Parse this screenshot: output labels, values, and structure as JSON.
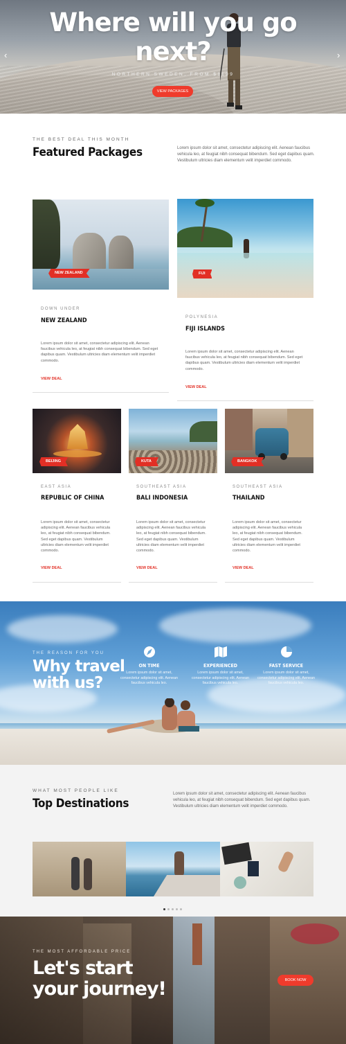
{
  "hero": {
    "title_line1": "Where will you go",
    "title_line2": "next?",
    "subtitle": "NORTHERN SWEDEN, FROM $1199",
    "cta": "VIEW PACKAGES"
  },
  "featured": {
    "eyebrow": "THE BEST DEAL THIS MONTH",
    "title": "Featured Packages",
    "description": "Lorem ipsum dolor sit amet, consectetur adipiscing elit. Aenean faucibus vehicula leo, at feugiat nibh consequat bibendum. Sed eget dapibus quam. Vestibulum ultricies diam elementum velit imperdiet commodo.",
    "cards": [
      {
        "tag": "NEW ZEALAND",
        "region": "DOWN UNDER",
        "name": "NEW ZEALAND",
        "desc": "Lorem ipsum dolor sit amet, consectetur adipiscing elit. Aenean faucibus vehicula leo, at feugiat nibh consequat bibendum. Sed eget dapibus quam. Vestibulum ultricies diam elementum velit imperdiet commodo.",
        "cta": "VIEW DEAL"
      },
      {
        "tag": "FIJI",
        "region": "POLYNESIA",
        "name": "FIJI ISLANDS",
        "desc": "Lorem ipsum dolor sit amet, consectetur adipiscing elit. Aenean faucibus vehicula leo, at feugiat nibh consequat bibendum. Sed eget dapibus quam. Vestibulum ultricies diam elementum velit imperdiet commodo.",
        "cta": "VIEW DEAL"
      },
      {
        "tag": "BEIJING",
        "region": "EAST ASIA",
        "name": "REPUBLIC OF CHINA",
        "desc": "Lorem ipsum dolor sit amet, consectetur adipiscing elit. Aenean faucibus vehicula leo, at feugiat nibh consequat bibendum. Sed eget dapibus quam. Vestibulum ultricies diam elementum velit imperdiet commodo.",
        "cta": "VIEW DEAL"
      },
      {
        "tag": "KUTA",
        "region": "SOUTHEAST ASIA",
        "name": "BALI INDONESIA",
        "desc": "Lorem ipsum dolor sit amet, consectetur adipiscing elit. Aenean faucibus vehicula leo, at feugiat nibh consequat bibendum. Sed eget dapibus quam. Vestibulum ultricies diam elementum velit imperdiet commodo.",
        "cta": "VIEW DEAL"
      },
      {
        "tag": "BANGKOK",
        "region": "SOUTHEAST ASIA",
        "name": "THAILAND",
        "desc": "Lorem ipsum dolor sit amet, consectetur adipiscing elit. Aenean faucibus vehicula leo, at feugiat nibh consequat bibendum. Sed eget dapibus quam. Vestibulum ultricies diam elementum velit imperdiet commodo.",
        "cta": "VIEW DEAL"
      }
    ]
  },
  "why": {
    "eyebrow": "THE REASON FOR YOU",
    "title": "Why travel with us?",
    "features": [
      {
        "icon": "compass-icon",
        "title": "ON TIME",
        "desc": "Lorem ipsum dolor sit amet, consectetur adipiscing elit. Aenean faucibus vehicula leo."
      },
      {
        "icon": "map-icon",
        "title": "EXPERIENCED",
        "desc": "Lorem ipsum dolor sit amet, consectetur adipiscing elit. Aenean faucibus vehicula leo."
      },
      {
        "icon": "pie-chart-icon",
        "title": "FAST SERVICE",
        "desc": "Lorem ipsum dolor sit amet, consectetur adipiscing elit. Aenean faucibus vehicula leo."
      }
    ]
  },
  "destinations": {
    "eyebrow": "WHAT MOST PEOPLE LIKE",
    "title": "Top Destinations",
    "description": "Lorem ipsum dolor sit amet, consectetur adipiscing elit. Aenean faucibus vehicula leo, at feugiat nibh consequat bibendum. Sed eget dapibus quam. Vestibulum ultricies diam elementum velit imperdiet commodo."
  },
  "journey": {
    "eyebrow": "THE MOST AFFORDABLE PRICE",
    "title_line1": "Let's start",
    "title_line2": "your journey!",
    "cta": "BOOK NOW"
  },
  "colors": {
    "accent": "#ef3b2c",
    "sky": "#5f9fd6"
  }
}
